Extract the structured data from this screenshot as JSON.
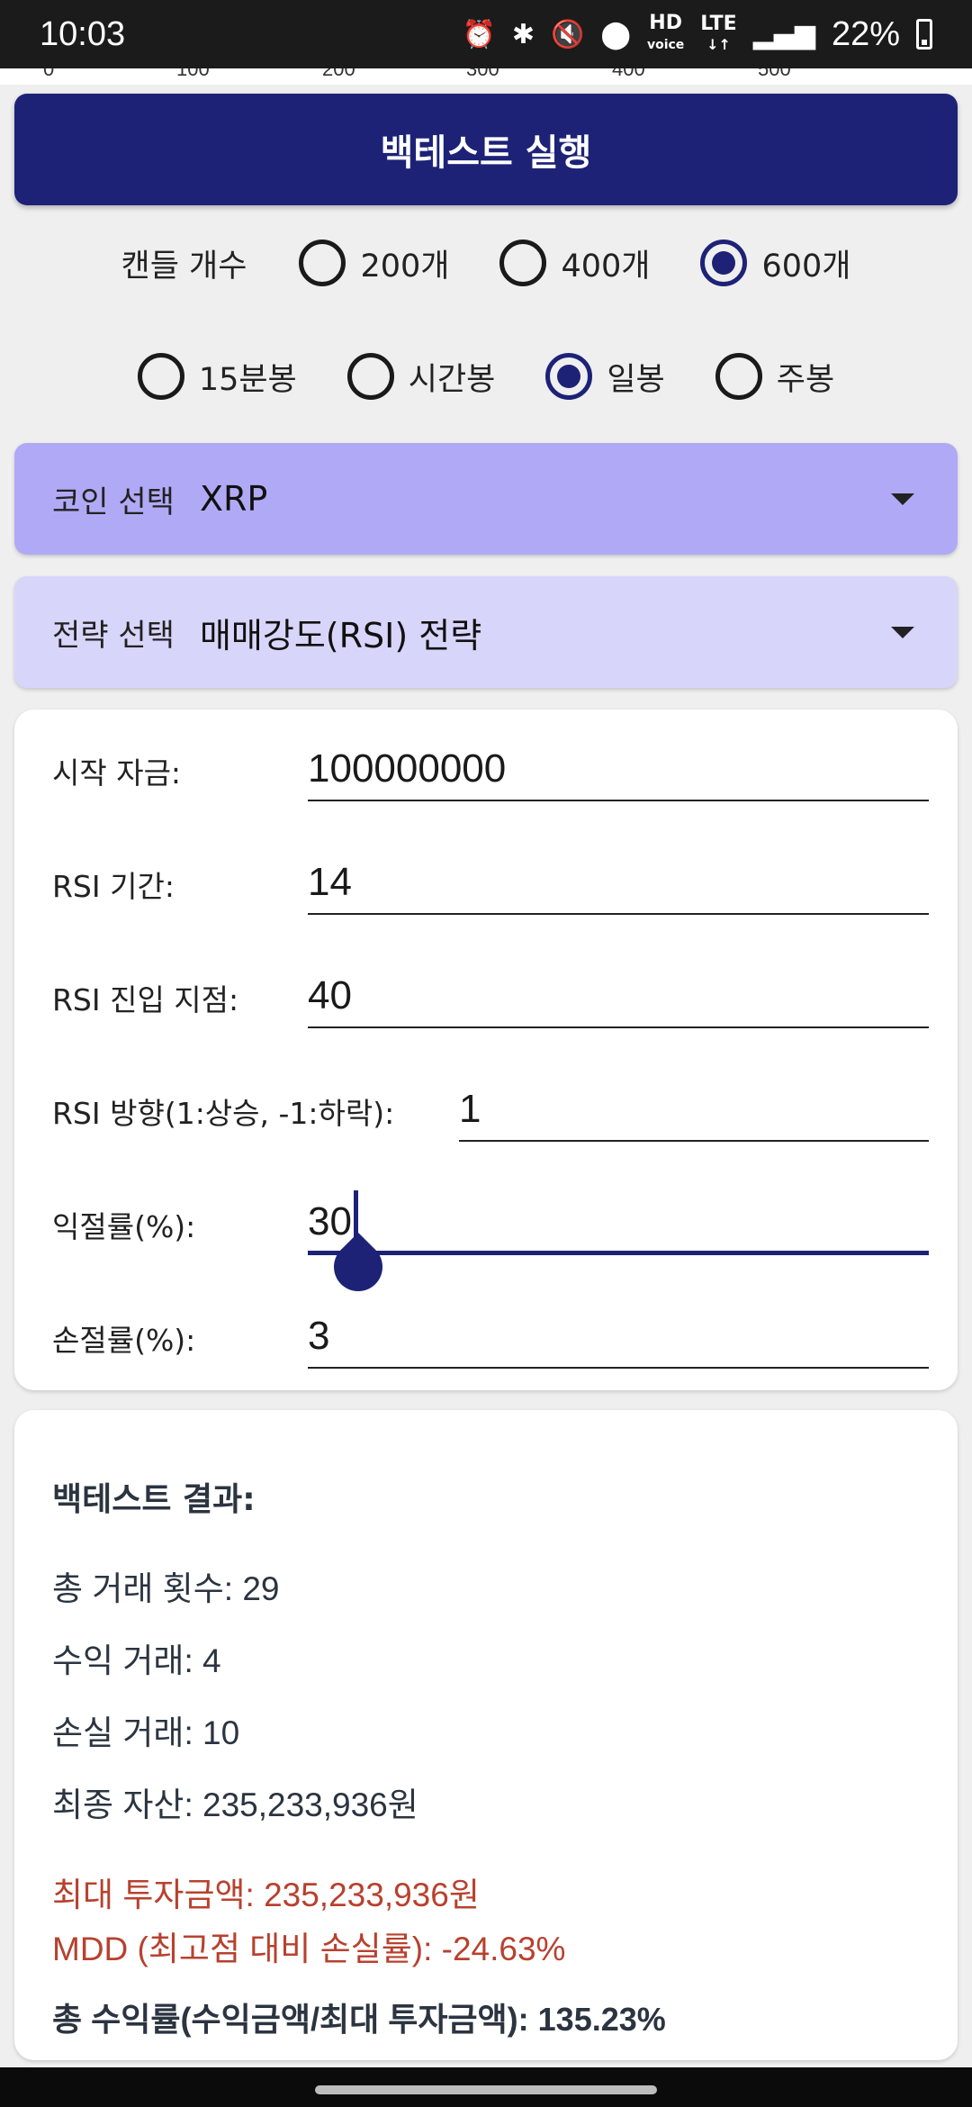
{
  "status": {
    "time": "10:03",
    "hd_label": "HD",
    "voice_label": "voice",
    "lte_label": "LTE",
    "battery_pct": "22%"
  },
  "chart_axis": {
    "ticks": [
      "0",
      "100",
      "200",
      "300",
      "400",
      "500"
    ]
  },
  "run_button": {
    "label": "백테스트 실행"
  },
  "candle_count": {
    "label": "캔들 개수",
    "options": [
      "200개",
      "400개",
      "600개"
    ],
    "selected": "600개"
  },
  "interval": {
    "options": [
      "15분봉",
      "시간봉",
      "일봉",
      "주봉"
    ],
    "selected": "일봉"
  },
  "coin_select": {
    "label": "코인 선택",
    "value": "XRP",
    "color": "#b0aaf6"
  },
  "strategy_select": {
    "label": "전략 선택",
    "value": "매매강도(RSI) 전략",
    "color": "#d8d5fb"
  },
  "params": {
    "start_capital": {
      "label": "시작 자금:",
      "value": "100000000"
    },
    "rsi_period": {
      "label": "RSI 기간:",
      "value": "14"
    },
    "rsi_entry": {
      "label": "RSI 진입 지점:",
      "value": "40"
    },
    "rsi_direction": {
      "label": "RSI 방향(1:상승, -1:하락):",
      "value": "1"
    },
    "take_profit": {
      "label": "익절률(%):",
      "value": "30"
    },
    "stop_loss": {
      "label": "손절률(%):",
      "value": "3"
    }
  },
  "results": {
    "title": "백테스트 결과:",
    "total_trades": "총 거래 횟수: 29",
    "profit_trades": "수익 거래: 4",
    "loss_trades": "손실 거래: 10",
    "final_assets": "최종 자산: 235,233,936원",
    "max_investment": "최대 투자금액: 235,233,936원",
    "mdd": "MDD (최고점 대비 손실률): -24.63%",
    "total_return": "총 수익률(수익금액/최대 투자금액): 135.23%"
  },
  "colors": {
    "primary": "#1d2277",
    "warning_text": "#b8412e"
  }
}
